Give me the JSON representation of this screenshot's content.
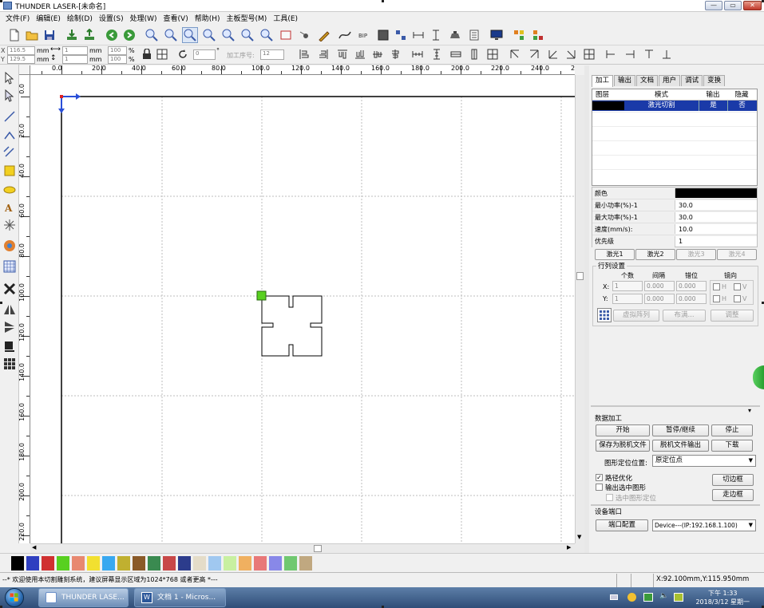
{
  "app": {
    "title": "THUNDER LASER-[未命名]"
  },
  "menu": {
    "items": [
      "文件(F)",
      "编辑(E)",
      "绘制(D)",
      "设置(S)",
      "处理(W)",
      "查看(V)",
      "帮助(H)",
      "主板型号(M)",
      "工具(E)"
    ]
  },
  "toolbar2": {
    "x_label": "X",
    "y_label": "Y",
    "x_value": "116.5",
    "y_value": "129.5",
    "unit_mm": "mm",
    "w_value": "1",
    "h_value": "1",
    "pct_w": "100",
    "pct_h": "100",
    "pct": "%",
    "rotate_value": "0",
    "degree": "°",
    "proc_order_label": "加工序号:",
    "proc_order_value": "12"
  },
  "ruler": {
    "top_labels": [
      "0.0",
      "20.0",
      "40.0",
      "60.0",
      "80.0",
      "100.0",
      "120.0",
      "140.0",
      "160.0",
      "180.0",
      "200.0",
      "220.0",
      "240.0",
      "260.0"
    ],
    "left_labels": [
      "0.0",
      "20.0",
      "40.0",
      "60.0",
      "80.0",
      "100.0",
      "120.0",
      "140.0",
      "160.0",
      "180.0",
      "200.0",
      "220.0"
    ]
  },
  "panel": {
    "tabs": [
      "加工",
      "输出",
      "文档",
      "用户",
      "调试",
      "变换"
    ],
    "active_tab": "加工",
    "layer_table": {
      "headers": [
        "图层",
        "模式",
        "输出",
        "隐藏"
      ],
      "rows": [
        {
          "color": "#000000",
          "mode": "激光切割",
          "output": "是",
          "hidden": "否"
        }
      ]
    },
    "params": [
      {
        "label": "颜色",
        "value": ""
      },
      {
        "label": "最小功率(%)-1",
        "value": "30.0"
      },
      {
        "label": "最大功率(%)-1",
        "value": "30.0"
      },
      {
        "label": "速度(mm/s):",
        "value": "10.0"
      },
      {
        "label": "优先级",
        "value": "1"
      }
    ],
    "laser_buttons": [
      "激光1",
      "激光2",
      "激光3",
      "激光4"
    ],
    "array": {
      "title": "行列设置",
      "col_count": "个数",
      "col_interval": "间隔",
      "col_offset": "错位",
      "col_mirror": "镜向",
      "x_label": "X:",
      "y_label": "Y:",
      "x_count": "1",
      "x_interval": "0.000",
      "x_offset": "0.000",
      "y_count": "1",
      "y_interval": "0.000",
      "y_offset": "0.000",
      "h_label": "H",
      "v_label": "V",
      "virtual_array": "虚拟阵列",
      "fill": "布满...",
      "adjust": "调整"
    },
    "data_process": {
      "title": "数据加工",
      "start": "开始",
      "pause": "暂停/继续",
      "stop": "停止",
      "save_offline": "保存为脱机文件",
      "offline_output": "脱机文件输出",
      "download": "下载",
      "position_label": "图形定位位置:",
      "position_value": "原定位点",
      "path_opt": "路径优化",
      "output_selected": "输出选中图形",
      "selected_position": "选中图形定位",
      "cut_frame": "切边框",
      "walk_frame": "走边框"
    },
    "device": {
      "title": "设备端口",
      "port_config": "端口配置",
      "device_value": "Device---(IP:192.168.1.100)"
    }
  },
  "palette": {
    "colors": [
      "#000000",
      "#2f3fc0",
      "#d03030",
      "#58d020",
      "#e88870",
      "#f2e030",
      "#38a8f0",
      "#c0b030",
      "#8a5a28",
      "#3a8a50",
      "#c84848",
      "#2c3c8c",
      "#e4dcc8",
      "#a0c8f0",
      "#c8f0a0",
      "#f0b060",
      "#e87878",
      "#8888e8",
      "#70c870",
      "#c0a880"
    ]
  },
  "status": {
    "message": "--* 欢迎使用本切割雕刻系统，建议屏幕显示区域为1024*768 或者更高 *---",
    "coords": "X:92.100mm,Y:115.950mm"
  },
  "taskbar": {
    "tasks": [
      "THUNDER LASE...",
      "文档 1 - Micros..."
    ],
    "time": "下午 1:33",
    "date": "2018/3/12 星期一"
  }
}
